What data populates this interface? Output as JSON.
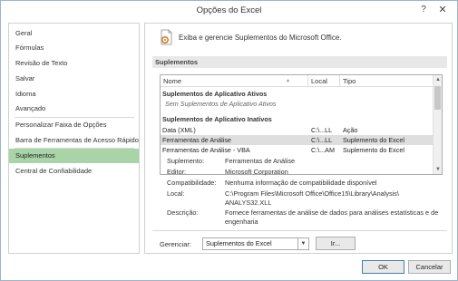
{
  "window": {
    "title": "Opções do Excel",
    "help_glyph": "?",
    "close_glyph": "✕"
  },
  "sidebar": {
    "items": [
      {
        "label": "Geral"
      },
      {
        "label": "Fórmulas"
      },
      {
        "label": "Revisão de Texto"
      },
      {
        "label": "Salvar"
      },
      {
        "label": "Idioma"
      },
      {
        "label": "Avançado"
      },
      {
        "label": "Personalizar Faixa de Opções"
      },
      {
        "label": "Barra de Ferramentas de Acesso Rápido"
      },
      {
        "label": "Suplementos"
      },
      {
        "label": "Central de Confiabilidade"
      }
    ],
    "selected": "Suplementos"
  },
  "header": {
    "icon": "addins-gear-icon",
    "text": "Exiba e gerencie Suplementos do Microsoft Office."
  },
  "section": {
    "title": "Suplementos"
  },
  "list": {
    "columns": {
      "name": "Nome",
      "location": "Local",
      "type": "Tipo"
    },
    "sort_indicator": "▲",
    "active_group": "Suplementos de Aplicativo Ativos",
    "active_none": "Sem Suplementos de Aplicativo Ativos",
    "inactive_group": "Suplementos de Aplicativo Inativos",
    "rows": [
      {
        "name": "Data (XML)",
        "location": "C:\\...LL",
        "type": "Ação"
      },
      {
        "name": "Ferramentas de Análise",
        "location": "C:\\...LL",
        "type": "Suplemento do Excel"
      },
      {
        "name": "Ferramentas de Análise - VBA",
        "location": "C:\\...AM",
        "type": "Suplemento do Excel"
      }
    ]
  },
  "details": {
    "addin_label": "Suplemento:",
    "addin_value": "Ferramentas de Análise",
    "publisher_label": "Editor:",
    "publisher_value": "Microsoft Corporation",
    "compat_label": "Compatibilidade:",
    "compat_value": "Nenhuma informação de compatibilidade disponível",
    "location_label": "Local:",
    "location_value": "C:\\Program Files\\Microsoft Office\\Office15\\Library\\Analysis\\ ANALYS32.XLL",
    "desc_label": "Descrição:",
    "desc_value": "Fornece ferramentas de análise de dados para análises estatísticas e de engenharia"
  },
  "manage": {
    "label": "Gerenciar:",
    "selected": "Suplementos do Excel",
    "go_label": "Ir..."
  },
  "footer": {
    "ok_label": "OK",
    "cancel_label": "Cancelar"
  }
}
